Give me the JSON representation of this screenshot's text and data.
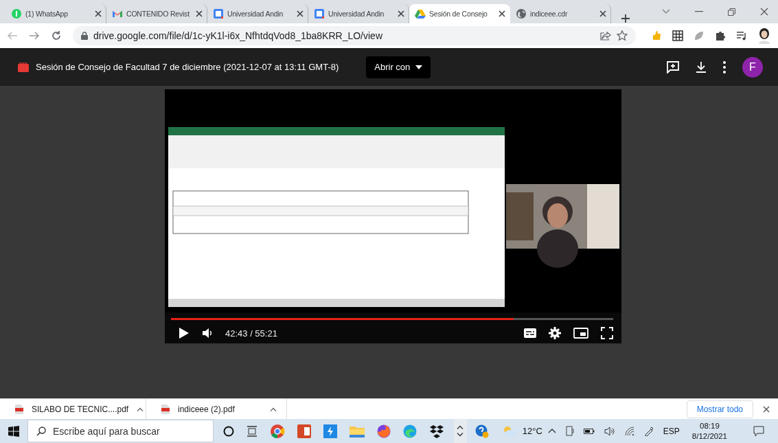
{
  "browser": {
    "tabs": [
      {
        "kind": "whatsapp",
        "title": "(1) WhatsApp",
        "selected": false
      },
      {
        "kind": "gmail",
        "title": "CONTENIDO Revist",
        "selected": false
      },
      {
        "kind": "calendar",
        "title": "Universidad Andin",
        "selected": false
      },
      {
        "kind": "calendar",
        "title": "Universidad Andin",
        "selected": false
      },
      {
        "kind": "drive",
        "title": "Sesión de Consejo",
        "selected": true
      },
      {
        "kind": "globe",
        "title": "indiceee.cdr",
        "selected": false
      }
    ],
    "url": "drive.google.com/file/d/1c-yK1l-i6x_NfhtdqVod8_1ba8KRR_LO/view"
  },
  "viewer": {
    "title": "Sesión de Consejo de Facultad 7 de diciembre (2021-12-07 at 13:11 GMT-8)",
    "open_with": "Abrir con",
    "avatar": "F"
  },
  "player": {
    "progress": {
      "level": 0.775
    },
    "time": "42:43 / 55:21"
  },
  "downloads": {
    "items": [
      "SILABO DE TECNIC....pdf",
      "indiceee (2).pdf"
    ],
    "show_all": "Mostrar todo"
  },
  "taskbar": {
    "search_placeholder": "Escribe aquí para buscar",
    "weather": "12°C",
    "language": "ESP",
    "time": "08:19",
    "date": "8/12/2021"
  }
}
